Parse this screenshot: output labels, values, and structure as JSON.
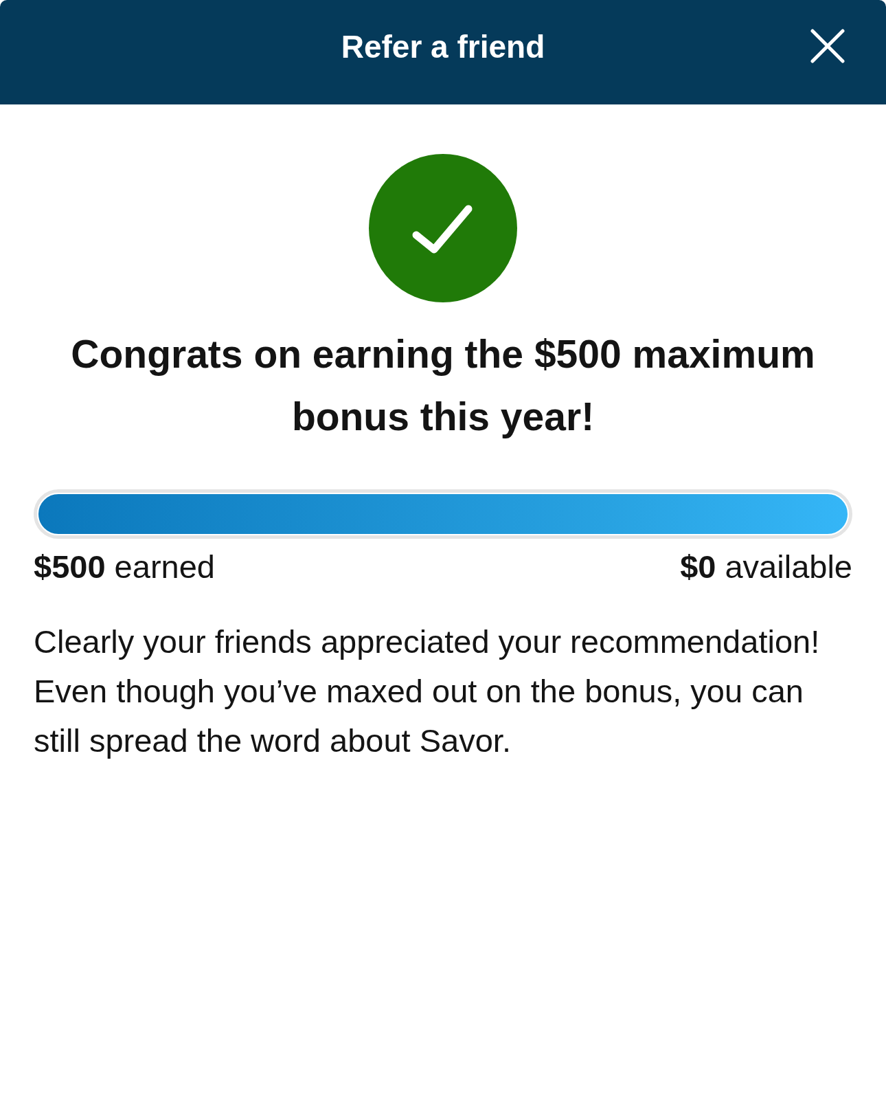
{
  "header": {
    "title": "Refer a friend"
  },
  "heading": "Congrats on earning the $500 maximum bonus this year!",
  "progress": {
    "level": 1,
    "earned": "**$500** earned",
    "available": "**$0** available"
  },
  "message": "Clearly your friends appreciated your recommendation! Even though you’ve maxed out on the bonus, you can still spread the word about Savor."
}
